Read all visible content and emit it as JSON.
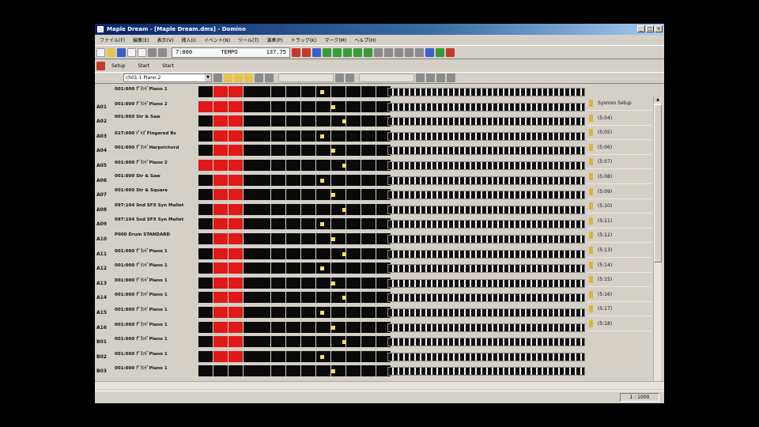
{
  "window": {
    "title": "Maple Dream - [Maple Dream.dms] - Domino",
    "controls": [
      "_",
      "□",
      "×"
    ]
  },
  "menu": [
    "ファイル(F)",
    "編集(E)",
    "表示(V)",
    "挿入(I)",
    "イベント(N)",
    "ツール(T)",
    "演奏(P)",
    "トラック(K)",
    "マーク(M)",
    "ヘルプ(H)"
  ],
  "toolbar": {
    "time_measure": "7:000",
    "tempo_label": "TEMPO",
    "tempo_value": "137.75"
  },
  "tabs": [
    "Setup",
    "Start",
    "Start"
  ],
  "instrument": {
    "selected": "ch01 1 Piano 2"
  },
  "tracks": [
    {
      "num": "",
      "name": "001:000 ｸﾞﾗﾝﾄﾞPiano 1"
    },
    {
      "num": "A01",
      "name": "001:000 ｸﾞﾗﾝﾄﾞPiano 2"
    },
    {
      "num": "A02",
      "name": "001:000 Str & Saw"
    },
    {
      "num": "A03",
      "name": "027:000 ｼﾞｬｽﾞFingered Bs"
    },
    {
      "num": "A04",
      "name": "001:000 ｸﾞﾗﾝﾄﾞHarpsichord"
    },
    {
      "num": "A05",
      "name": "001:000 ｸﾞﾗﾝﾄﾞPiano 2"
    },
    {
      "num": "A06",
      "name": "001:000 Str & Saw"
    },
    {
      "num": "A07",
      "name": "001:000 Str & Square"
    },
    {
      "num": "A08",
      "name": "097:104 Snd SFX Syn Mallet"
    },
    {
      "num": "A09",
      "name": "097:104 Snd SFX Syn Mallet"
    },
    {
      "num": "A10",
      "name": "P000 Drum STANDARD"
    },
    {
      "num": "A11",
      "name": "001:000 ｸﾞﾗﾝﾄﾞPiano 1"
    },
    {
      "num": "A12",
      "name": "001:000 ｸﾞﾗﾝﾄﾞPiano 1"
    },
    {
      "num": "A13",
      "name": "001:000 ｸﾞﾗﾝﾄﾞPiano 1"
    },
    {
      "num": "A14",
      "name": "001:000 ｸﾞﾗﾝﾄﾞPiano 1"
    },
    {
      "num": "A15",
      "name": "001:000 ｸﾞﾗﾝﾄﾞPiano 1"
    },
    {
      "num": "A16",
      "name": "001:000 ｸﾞﾗﾝﾄﾞPiano 1"
    },
    {
      "num": "B01",
      "name": "001:000 ｸﾞﾗﾝﾄﾞPiano 1"
    },
    {
      "num": "B02",
      "name": "001:000 ｸﾞﾗﾝﾄﾞPiano 1"
    },
    {
      "num": "B03",
      "name": "001:000 ｸﾞﾗﾝﾄﾞPiano 1"
    }
  ],
  "right_panel": [
    "Sysmsn Setup",
    "(5:04)",
    "(5:05)",
    "(5:06)",
    "(5:07)",
    "(5:08)",
    "(5:09)",
    "(5:10)",
    "(5:11)",
    "(5:12)",
    "(5:13)",
    "(5:14)",
    "(5:15)",
    "(5:16)",
    "(5:17)",
    "(5:18)"
  ],
  "status": {
    "position": "1 : 1000"
  },
  "colors": {
    "titlebar": "#0a246a",
    "cell_active": "#e01818",
    "cell_default": "#0a0a0a"
  }
}
